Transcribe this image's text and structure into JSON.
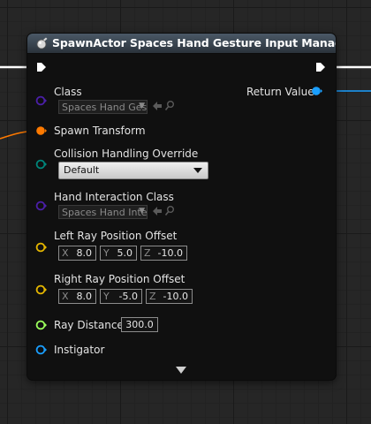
{
  "node": {
    "title": "SpawnActor Spaces Hand Gesture Input Manager",
    "icon": "spawn-actor-sphere-icon"
  },
  "pins": {
    "class": {
      "label": "Class",
      "value": "Spaces Hand Ges",
      "color": "#4b1fa8"
    },
    "spawn_transform": {
      "label": "Spawn Transform",
      "color": "#ff7a00"
    },
    "collision": {
      "label": "Collision Handling Override",
      "value": "Default",
      "color": "#00857a"
    },
    "hand_interaction_class": {
      "label": "Hand Interaction Class",
      "value": "Spaces Hand Inte",
      "color": "#4b1fa8"
    },
    "left_ray": {
      "label": "Left Ray Position Offset",
      "x": "8.0",
      "y": "5.0",
      "z": "-10.0",
      "color": "#e5b600"
    },
    "right_ray": {
      "label": "Right Ray Position Offset",
      "x": "8.0",
      "y": "-5.0",
      "z": "-10.0",
      "color": "#e5b600"
    },
    "ray_distance": {
      "label": "Ray Distance",
      "value": "300.0",
      "color": "#9bff5c"
    },
    "instigator": {
      "label": "Instigator",
      "color": "#1a9fff"
    },
    "return_value": {
      "label": "Return Value",
      "color": "#1a9fff"
    }
  },
  "axes": {
    "x": "X",
    "y": "Y",
    "z": "Z"
  },
  "colors": {
    "exec_wire": "#ffffff",
    "transform_wire": "#ff7a00",
    "object_wire": "#1a9fff"
  }
}
